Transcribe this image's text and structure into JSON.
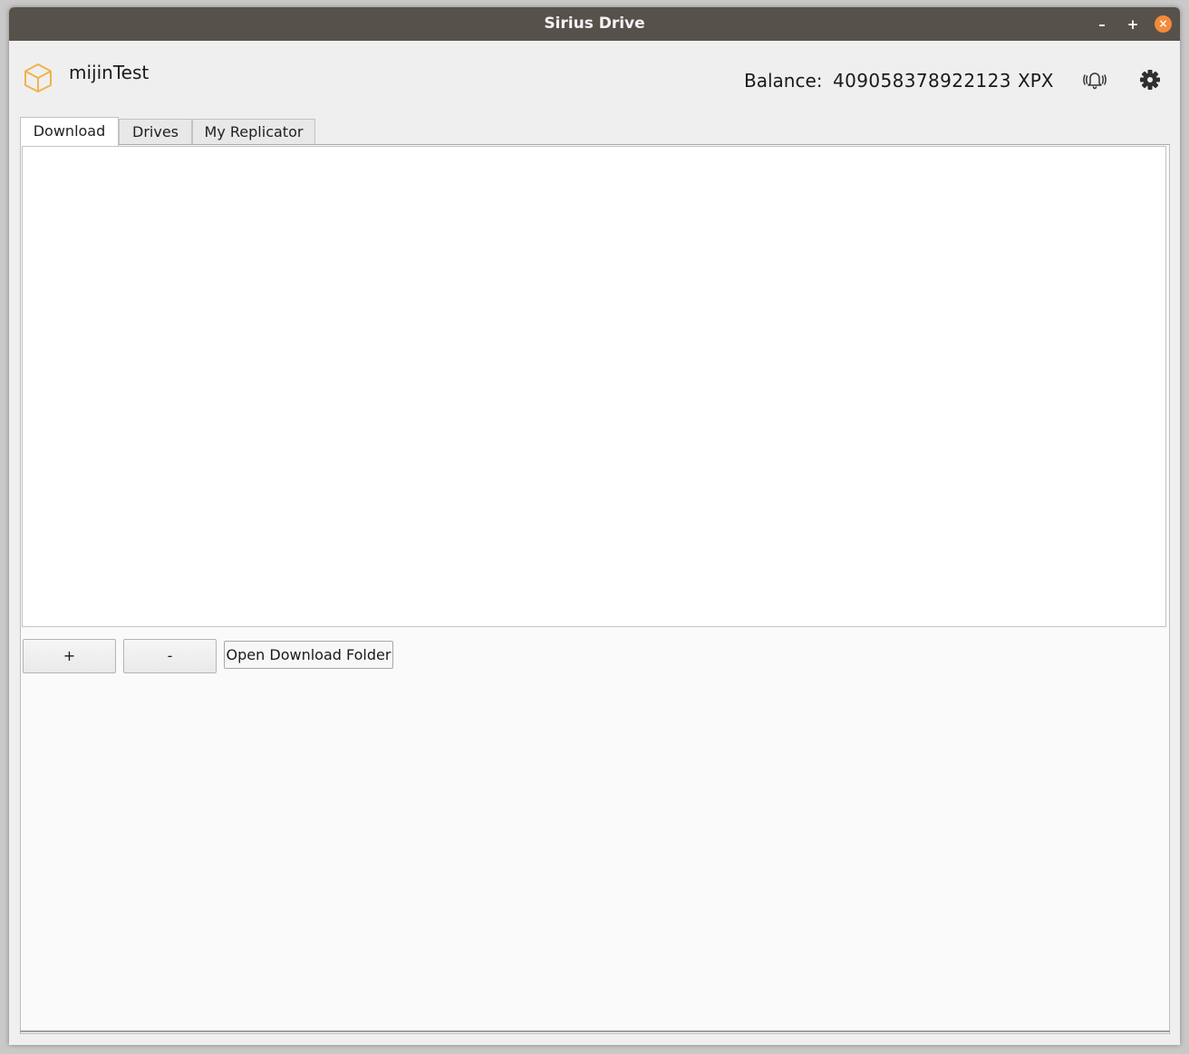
{
  "window": {
    "title": "Sirius Drive",
    "controls": {
      "minimize": "–",
      "maximize": "+",
      "close": "×"
    }
  },
  "header": {
    "account_name": "mijinTest",
    "logo_icon": "cube-icon",
    "balance_label": "Balance:",
    "balance_value": "409058378922123",
    "balance_unit": "XPX",
    "notifications_icon": "ringing-bell-icon",
    "settings_icon": "gear-icon"
  },
  "tabs": [
    {
      "label": "Download",
      "active": true
    },
    {
      "label": "Drives",
      "active": false
    },
    {
      "label": "My Replicator",
      "active": false
    }
  ],
  "download": {
    "add_label": "+",
    "remove_label": "-",
    "open_folder_label": "Open Download Folder"
  },
  "colors": {
    "titlebar": "#57514b",
    "close_button": "#f48a3a",
    "logo": "#f2b24a"
  }
}
